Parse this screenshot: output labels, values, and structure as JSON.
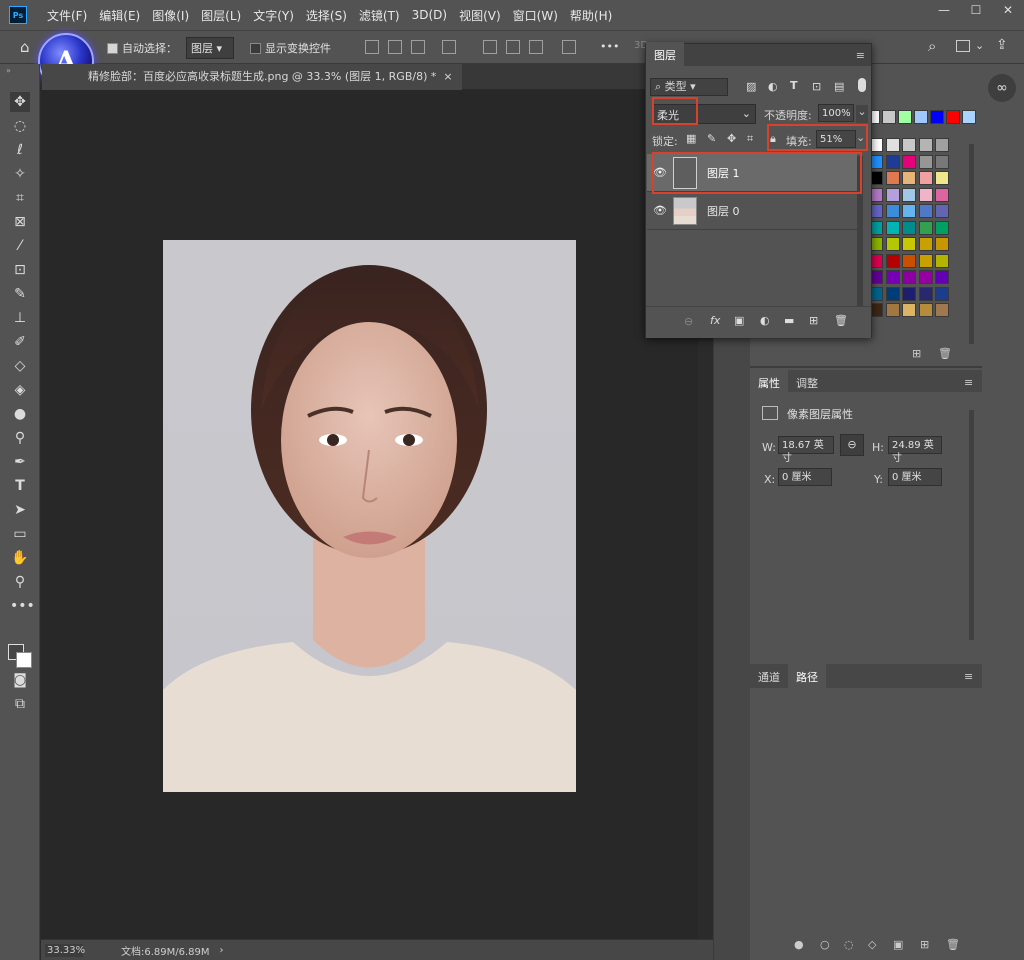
{
  "menubar": {
    "app_icon": "Ps",
    "items": [
      "文件(F)",
      "编辑(E)",
      "图像(I)",
      "图层(L)",
      "文字(Y)",
      "选择(S)",
      "滤镜(T)",
      "3D(D)",
      "视图(V)",
      "窗口(W)",
      "帮助(H)"
    ],
    "window_buttons": [
      "—",
      "☐",
      "✕"
    ]
  },
  "options": {
    "auto_select_label": "自动选择：",
    "auto_select_value": "图层",
    "show_transform_label": "显示变换控件",
    "more": "•••",
    "mode_3d": "3D"
  },
  "logo": {
    "letter": "A"
  },
  "document": {
    "tab_title": "精修脸部：百度必应高收录标题生成.png @ 33.3% (图层 1, RGB/8) *",
    "close": "×"
  },
  "status": {
    "zoom": "33.33%",
    "doc_info": "文档:6.89M/6.89M",
    "arrow": "›"
  },
  "layers_panel": {
    "tab": "图层",
    "filter_label": "类型",
    "blend_mode": "柔光",
    "opacity_label": "不透明度:",
    "opacity_value": "100%",
    "lock_label": "锁定:",
    "fill_label": "填充:",
    "fill_value": "51%",
    "layers": [
      {
        "name": "图层 1",
        "selected": true,
        "thumb": "gray"
      },
      {
        "name": "图层 0",
        "selected": false,
        "thumb": "portrait"
      }
    ],
    "footer_icons": [
      "link-icon",
      "fx-icon",
      "mask-icon",
      "adjustment-icon",
      "folder-icon",
      "new-layer-icon",
      "trash-icon"
    ],
    "fx": "fx"
  },
  "properties_panel": {
    "tabs": [
      "属性",
      "调整"
    ],
    "title": "像素图层属性",
    "w_label": "W:",
    "w_value": "18.67 英寸",
    "h_label": "H:",
    "h_value": "24.89 英寸",
    "x_label": "X:",
    "x_value": "0 厘米",
    "y_label": "Y:",
    "y_value": "0 厘米"
  },
  "paths_panel": {
    "tabs": [
      "通道",
      "路径"
    ]
  },
  "swatches": {
    "row0": [
      "#ffffff",
      "#c8c8c8",
      "#a0ffa0",
      "#a0c8ff",
      "#0000ff",
      "#ff0000",
      "#aad4ff"
    ],
    "grid": [
      [
        "#ffffff",
        "#e0e0e0",
        "#c8c8c8",
        "#b4b4b4",
        "#a0a0a0"
      ],
      [
        "#1e90ff",
        "#1e3c96",
        "#e6007a",
        "#969696",
        "#787878"
      ],
      [
        "#000000",
        "#e07850",
        "#e6b478",
        "#f0a0a0",
        "#f0e68c"
      ],
      [
        "#b478c8",
        "#b4a0dc",
        "#a0c8e6",
        "#f0b4c8",
        "#dc64a0"
      ],
      [
        "#6464c8",
        "#3c8cdc",
        "#64b4f0",
        "#5078c8",
        "#6464b4"
      ],
      [
        "#00a0a0",
        "#00b4b4",
        "#008c8c",
        "#32a050",
        "#00a064"
      ],
      [
        "#8cb400",
        "#b4c800",
        "#c8c800",
        "#c8a000",
        "#c89600"
      ],
      [
        "#dc0050",
        "#b40000",
        "#c85000",
        "#c8a000",
        "#b4b400"
      ],
      [
        "#640096",
        "#7800b4",
        "#8c00a0",
        "#9600a0",
        "#6400b4"
      ],
      [
        "#00648c",
        "#003c78",
        "#1e1e6e",
        "#28286e",
        "#1e3c8c"
      ],
      [
        "#3c2814",
        "#a07840",
        "#dcb464",
        "#b48c3c",
        "#a07850"
      ]
    ]
  }
}
